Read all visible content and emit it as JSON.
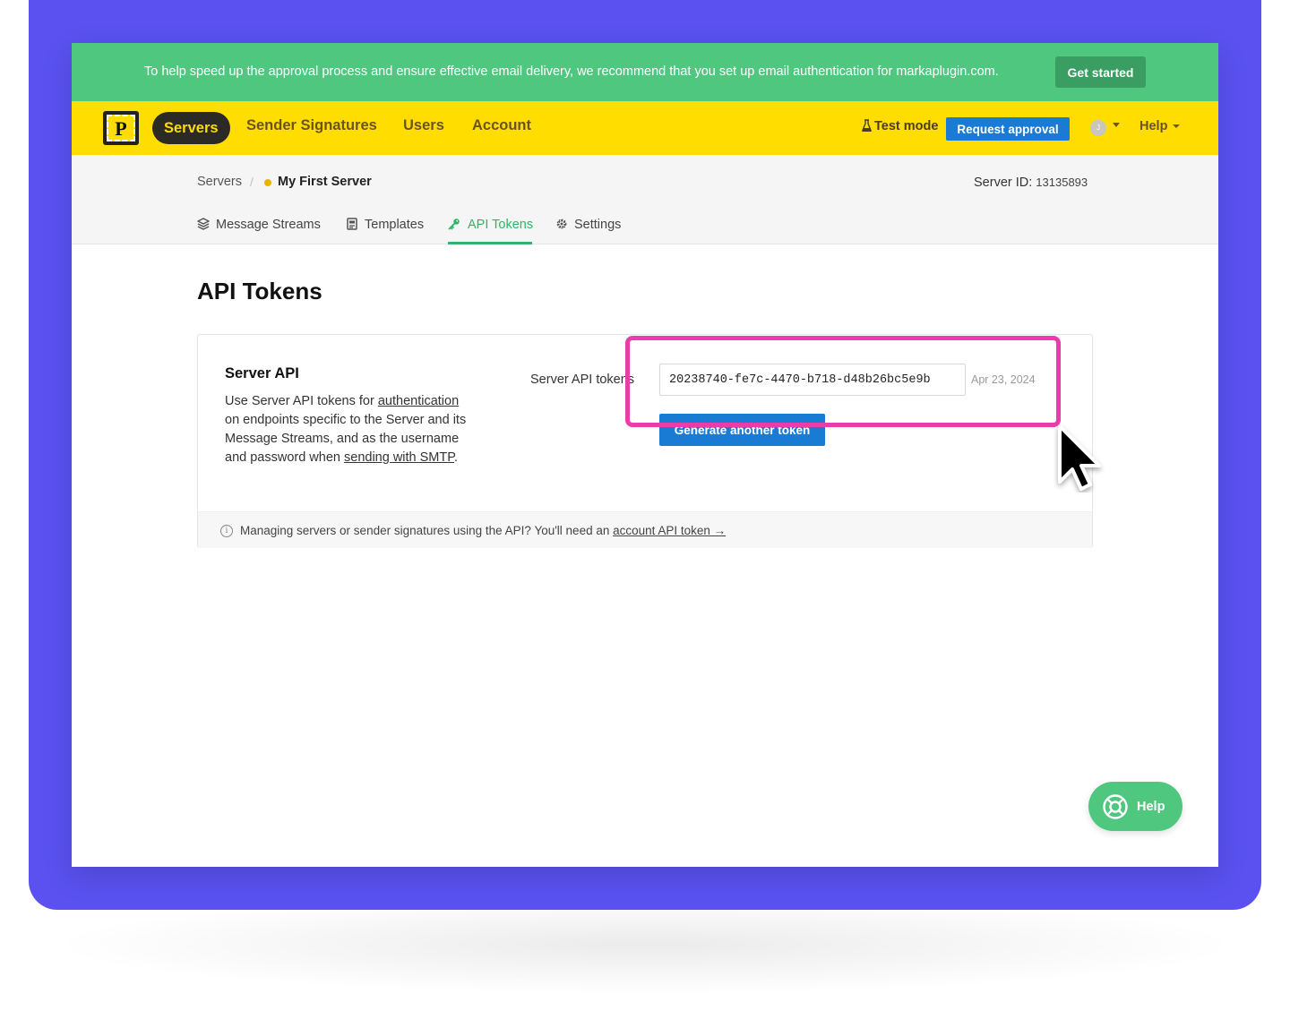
{
  "banner": {
    "text": "To help speed up the approval process and ensure effective email delivery, we recommend that you set up email authentication for markaplugin.com.",
    "button_label": "Get started"
  },
  "nav": {
    "logo_letter": "P",
    "items": [
      {
        "label": "Servers",
        "active": true
      },
      {
        "label": "Sender Signatures",
        "active": false
      },
      {
        "label": "Users",
        "active": false
      },
      {
        "label": "Account",
        "active": false
      }
    ],
    "test_mode": "Test mode",
    "request_approval": "Request approval",
    "avatar_initial": "J",
    "help": "Help"
  },
  "breadcrumb": {
    "root": "Servers",
    "separator": "/",
    "current": "My First Server"
  },
  "server_id": {
    "label": "Server ID:",
    "value": "13135893"
  },
  "tabs": [
    {
      "label": "Message Streams",
      "icon": "layers-icon",
      "active": false
    },
    {
      "label": "Templates",
      "icon": "template-icon",
      "active": false
    },
    {
      "label": "API Tokens",
      "icon": "key-icon",
      "active": true
    },
    {
      "label": "Settings",
      "icon": "gear-icon",
      "active": false
    }
  ],
  "page": {
    "title": "API Tokens"
  },
  "server_api": {
    "heading": "Server API",
    "desc_1": "Use Server API tokens for",
    "desc_link_1": "authentication",
    "desc_2": " on endpoints specific to the Server and its Message Streams, and as the username and password when ",
    "desc_link_2": "sending with SMTP",
    "desc_3": ".",
    "token_label": "Server API tokens",
    "token_value": "20238740-fe7c-4470-b718-d48b26bc5e9b",
    "token_date": "Apr 23, 2024",
    "generate_button": "Generate another token"
  },
  "footer_note": {
    "text": "Managing servers or sender signatures using the API? You'll need an ",
    "link": "account API token →"
  },
  "help_fab": {
    "label": "Help"
  },
  "colors": {
    "frame": "#5a51f0",
    "banner": "#50c77f",
    "nav": "#ffdd00",
    "primary_button": "#1a7bd5",
    "accent_green": "#30b46a",
    "highlight": "#ec3cac"
  }
}
